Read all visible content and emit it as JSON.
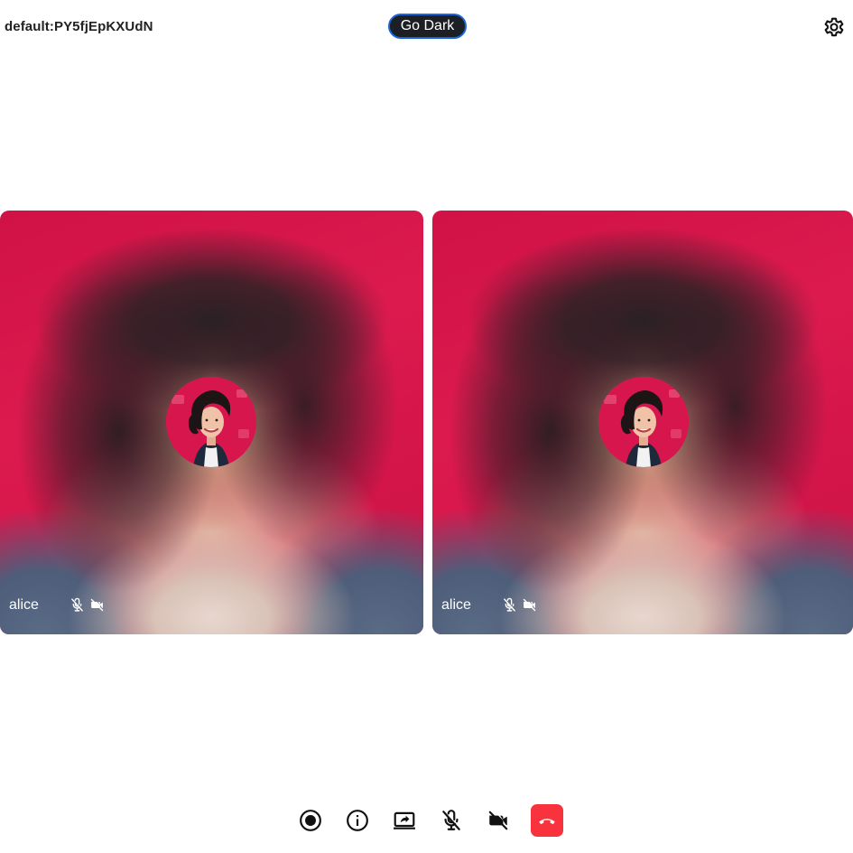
{
  "header": {
    "room_name": "default:PY5fjEpKXUdN",
    "theme_button_label": "Go Dark",
    "settings_icon": "gear-icon"
  },
  "tiles": [
    {
      "participant_name": "alice",
      "mic": "muted",
      "camera": "off",
      "avatar": "avatar-photo"
    },
    {
      "participant_name": "alice",
      "mic": "muted",
      "camera": "off",
      "avatar": "avatar-photo"
    }
  ],
  "toolbar": {
    "buttons": [
      {
        "name": "record",
        "icon": "record-icon"
      },
      {
        "name": "info",
        "icon": "info-icon"
      },
      {
        "name": "screen-share",
        "icon": "screen-share-icon"
      },
      {
        "name": "microphone",
        "icon": "mic-off-icon"
      },
      {
        "name": "camera",
        "icon": "camera-off-icon"
      },
      {
        "name": "hang-up",
        "icon": "phone-hangup-icon"
      }
    ]
  },
  "colors": {
    "hangup": "#f9333d",
    "theme_button_bg": "#1c1f24",
    "theme_button_border": "#1a66d6",
    "tile_background": "#d8164e"
  }
}
